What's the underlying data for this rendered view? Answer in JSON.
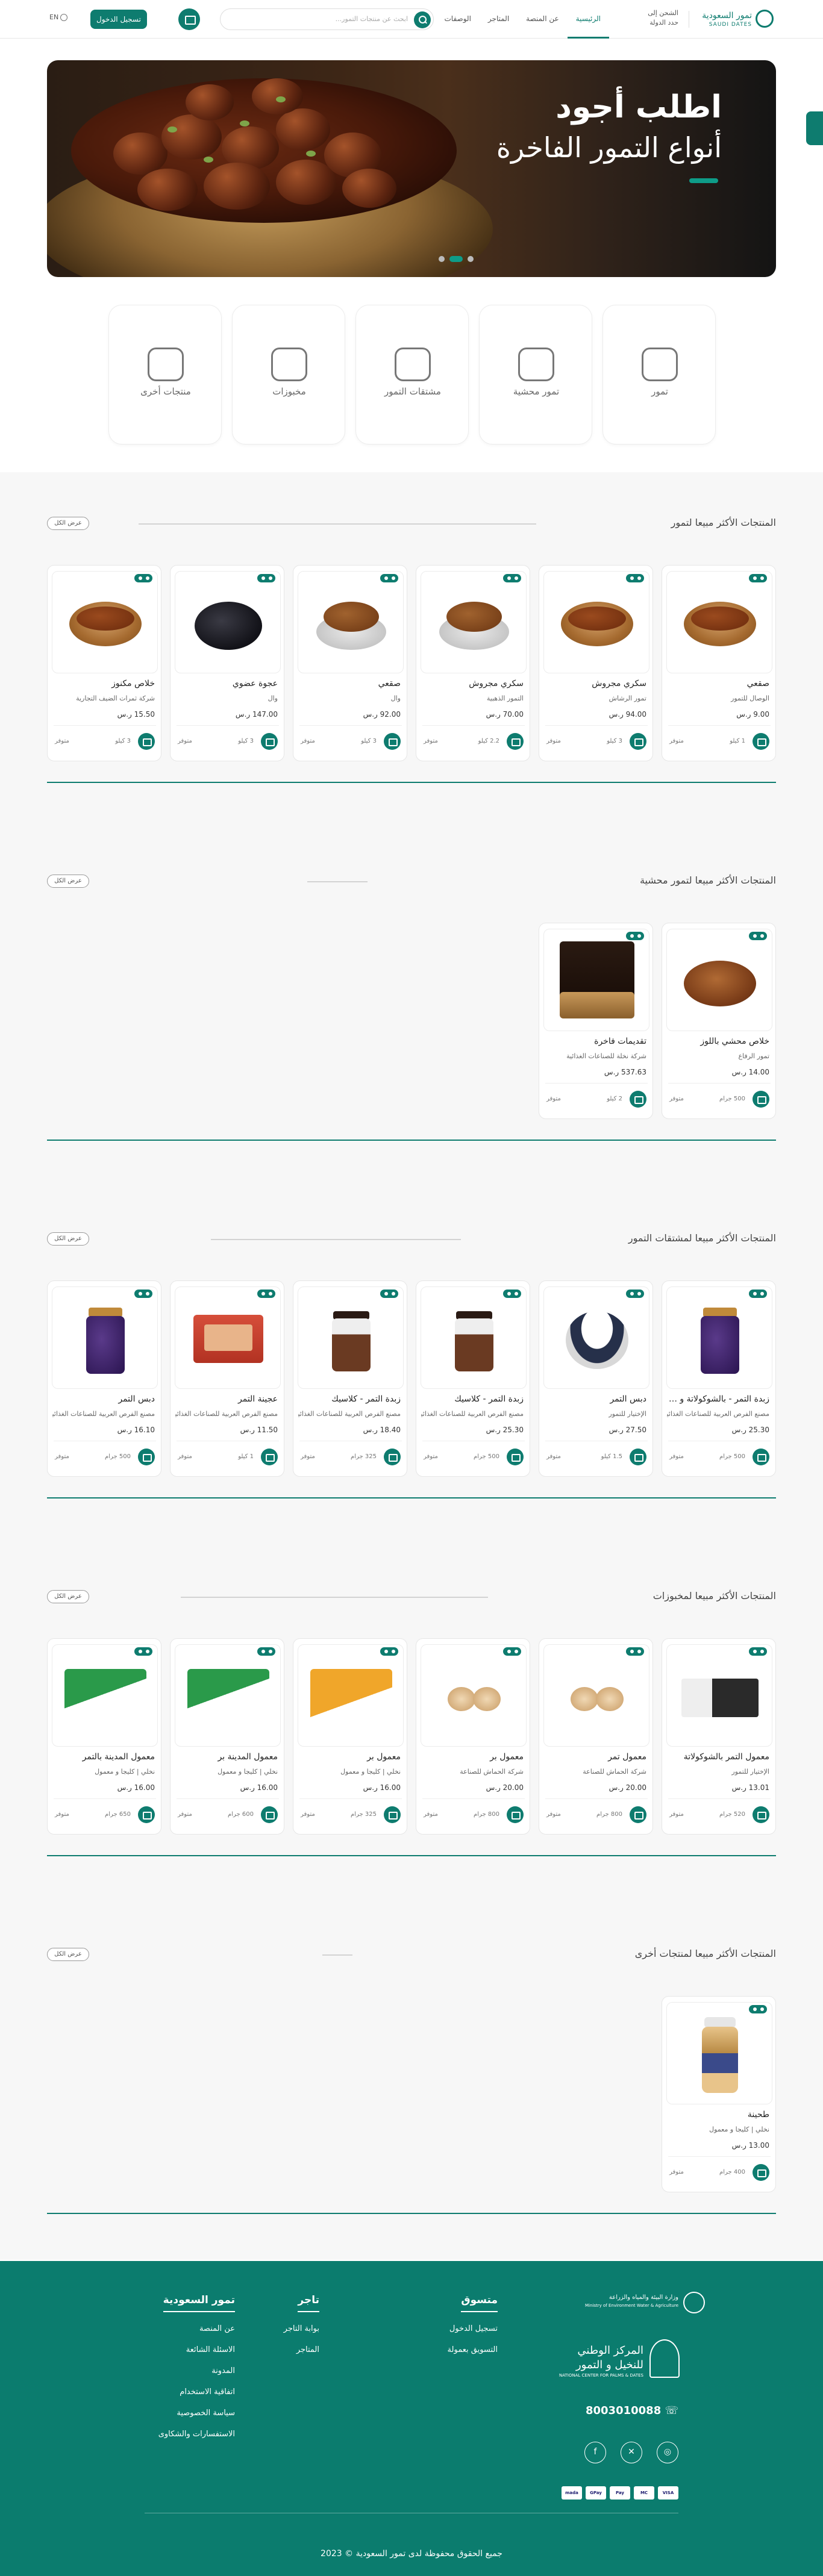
{
  "header": {
    "logo_ar": "تمور السعودية",
    "logo_en": "SAUDI DATES",
    "ship_label": "الشحن إلى",
    "ship_value": "حدد الدولة",
    "nav": [
      "الرئيسية",
      "عن المنصة",
      "المتاجر",
      "الوصفات"
    ],
    "search_placeholder": "ابحث عن منتجات التمور...",
    "login_label": "تسجيل الدخول",
    "lang_label": "EN"
  },
  "hero": {
    "title": "اطلب أجود",
    "subtitle": "أنواع التمور الفاخرة"
  },
  "categories": [
    "تمور",
    "تمور محشية",
    "مشتقات التمور",
    "مخبوزات",
    "منتجات أخرى"
  ],
  "view_all_label": "عرض الكل",
  "sections": [
    {
      "title": "المنتجات الأكثر مبيعا لتمور",
      "products": [
        {
          "name": "صقعي",
          "seller": "الوصال للتمور",
          "price": "9.00 ر.س",
          "weight": "1 كيلو",
          "stock": "متوفر",
          "img": "dates"
        },
        {
          "name": "سكري مجروش",
          "seller": "تمور الرشاش",
          "price": "94.00 ر.س",
          "weight": "3 كيلو",
          "stock": "متوفر",
          "img": "dates"
        },
        {
          "name": "سكري مجروش",
          "seller": "التمور الذهبية",
          "price": "70.00 ر.س",
          "weight": "2.2 كيلو",
          "stock": "متوفر",
          "img": "dates-bowl"
        },
        {
          "name": "صقعي",
          "seller": "وال",
          "price": "92.00 ر.س",
          "weight": "3 كيلو",
          "stock": "متوفر",
          "img": "dates-bowl"
        },
        {
          "name": "عجوة عضوي",
          "seller": "وال",
          "price": "147.00 ر.س",
          "weight": "3 كيلو",
          "stock": "متوفر",
          "img": "dark-dates"
        },
        {
          "name": "خلاص مكنوز",
          "seller": "شركة ثمرات الضيف التجارية",
          "price": "15.50 ر.س",
          "weight": "3 كيلو",
          "stock": "متوفر",
          "img": "dates"
        }
      ]
    },
    {
      "title": "المنتجات الأكثر مبيعا لتمور محشية",
      "products": [
        {
          "name": "خلاص محشي باللوز",
          "seller": "تمور الرفاع",
          "price": "14.00 ر.س",
          "weight": "500 جرام",
          "stock": "متوفر",
          "img": "dates-plate"
        },
        {
          "name": "تقديمات فاخرة",
          "seller": "شركة نخلة للصناعات الغذائية",
          "price": "537.63 ر.س",
          "weight": "2 كيلو",
          "stock": "متوفر",
          "img": "gift-box"
        }
      ]
    },
    {
      "title": "المنتجات الأكثر مبيعا لمشتقات التمور",
      "products": [
        {
          "name": "زبدة التمر - بالشوكولاتة و البندق",
          "seller": "مصنع الفرص العربية للصناعات الغذائية",
          "price": "25.30 ر.س",
          "weight": "500 جرام",
          "stock": "متوفر",
          "img": "jar-purple"
        },
        {
          "name": "دبس التمر",
          "seller": "الإختيار للتمور",
          "price": "27.50 ر.س",
          "weight": "1.5 كيلو",
          "stock": "متوفر",
          "img": "tub"
        },
        {
          "name": "زبدة التمر - كلاسيك",
          "seller": "مصنع الفرص العربية للصناعات الغذائية",
          "price": "25.30 ر.س",
          "weight": "500 جرام",
          "stock": "متوفر",
          "img": "jar-brown"
        },
        {
          "name": "زبدة التمر - كلاسيك",
          "seller": "مصنع الفرص العربية للصناعات الغذائية",
          "price": "18.40 ر.س",
          "weight": "325 جرام",
          "stock": "متوفر",
          "img": "jar-brown"
        },
        {
          "name": "عجينة التمر",
          "seller": "مصنع الفرص العربية للصناعات الغذائية",
          "price": "11.50 ر.س",
          "weight": "1 كيلو",
          "stock": "متوفر",
          "img": "paste"
        },
        {
          "name": "دبس التمر",
          "seller": "مصنع الفرص العربية للصناعات الغذائية",
          "price": "16.10 ر.س",
          "weight": "500 جرام",
          "stock": "متوفر",
          "img": "jar-purple"
        }
      ]
    },
    {
      "title": "المنتجات الأكثر مبيعا لمخبوزات",
      "products": [
        {
          "name": "معمول التمر بالشوكولاتة",
          "seller": "الإختيار للتمور",
          "price": "13.01 ر.س",
          "weight": "520 جرام",
          "stock": "متوفر",
          "img": "box-dark"
        },
        {
          "name": "معمول تمر",
          "seller": "شركة الحماش للصناعة",
          "price": "20.00 ر.س",
          "weight": "800 جرام",
          "stock": "متوفر",
          "img": "cookies"
        },
        {
          "name": "معمول بر",
          "seller": "شركة الحماش للصناعة",
          "price": "20.00 ر.س",
          "weight": "800 جرام",
          "stock": "متوفر",
          "img": "cookies"
        },
        {
          "name": "معمول بر",
          "seller": "نخلي | كليجا و معمول",
          "price": "16.00 ر.س",
          "weight": "325 جرام",
          "stock": "متوفر",
          "img": "box-orange"
        },
        {
          "name": "معمول المدينة بر",
          "seller": "نخلي | كليجا و معمول",
          "price": "16.00 ر.س",
          "weight": "600 جرام",
          "stock": "متوفر",
          "img": "box-green"
        },
        {
          "name": "معمول المدينة بالتمر",
          "seller": "نخلي | كليجا و معمول",
          "price": "16.00 ر.س",
          "weight": "650 جرام",
          "stock": "متوفر",
          "img": "box-green"
        }
      ]
    },
    {
      "title": "المنتجات الأكثر مبيعا لمنتجات أخرى",
      "products": [
        {
          "name": "طحينة",
          "seller": "نخلي | كليجا و معمول",
          "price": "13.00 ر.س",
          "weight": "400 جرام",
          "stock": "متوفر",
          "img": "bottle"
        }
      ]
    }
  ],
  "footer": {
    "ministry": "وزارة البيئة والمياه والزراعة",
    "ministry_en": "Ministry of Environment Water & Agriculture",
    "center_1": "المركز الوطني",
    "center_2": "للنخيل و التمور",
    "center_en": "NATIONAL CENTER FOR PALMS & DATES",
    "phone": "8003010088",
    "columns": [
      {
        "title": "تمور السعودية",
        "items": [
          "عن المنصة",
          "الاسئلة الشائعة",
          "المدونة",
          "اتفاقية الاستخدام",
          "سياسة الخصوصية",
          "الاستفسارات والشكاوى"
        ]
      },
      {
        "title": "تاجر",
        "items": [
          "بوابة التاجر",
          "المتاجر"
        ]
      },
      {
        "title": "متسوق",
        "items": [
          "تسجيل الدخول",
          "التسويق بعمولة"
        ]
      }
    ],
    "social": [
      "instagram-icon",
      "twitter-icon",
      "facebook-icon"
    ],
    "payments": [
      "VISA",
      "MC",
      "Pay",
      "GPay",
      "mada"
    ],
    "copyright": "جميع الحقوق محفوظة لدى تمور السعودية © 2023"
  }
}
